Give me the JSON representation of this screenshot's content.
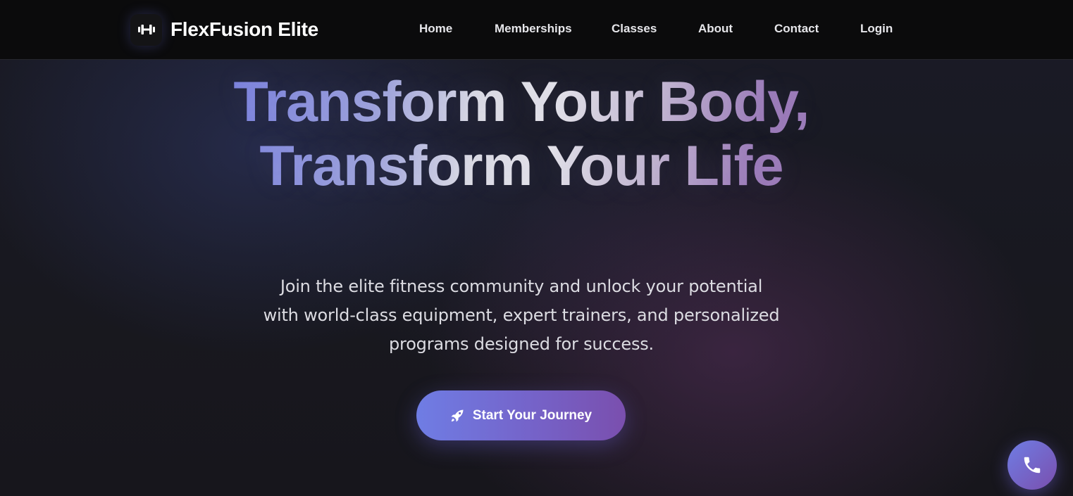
{
  "brand": {
    "name": "FlexFusion Elite",
    "logo_icon": "dumbbell-icon"
  },
  "nav": {
    "items": [
      {
        "label": "Home"
      },
      {
        "label": "Memberships"
      },
      {
        "label": "Classes"
      },
      {
        "label": "About"
      },
      {
        "label": "Contact"
      },
      {
        "label": "Login"
      }
    ]
  },
  "hero": {
    "title": "Transform Your Body, Transform Your Life",
    "subtitle": "Join the elite fitness community and unlock your potential with world-class equipment, expert trainers, and personalized programs designed for success.",
    "cta_label": "Start Your Journey",
    "cta_icon": "rocket-icon"
  },
  "floating_button": {
    "icon": "phone-icon"
  },
  "colors": {
    "accent_start": "#6f7de4",
    "accent_end": "#7a4fae",
    "nav_background": "#0b0b0c",
    "page_background": "#18181f"
  }
}
